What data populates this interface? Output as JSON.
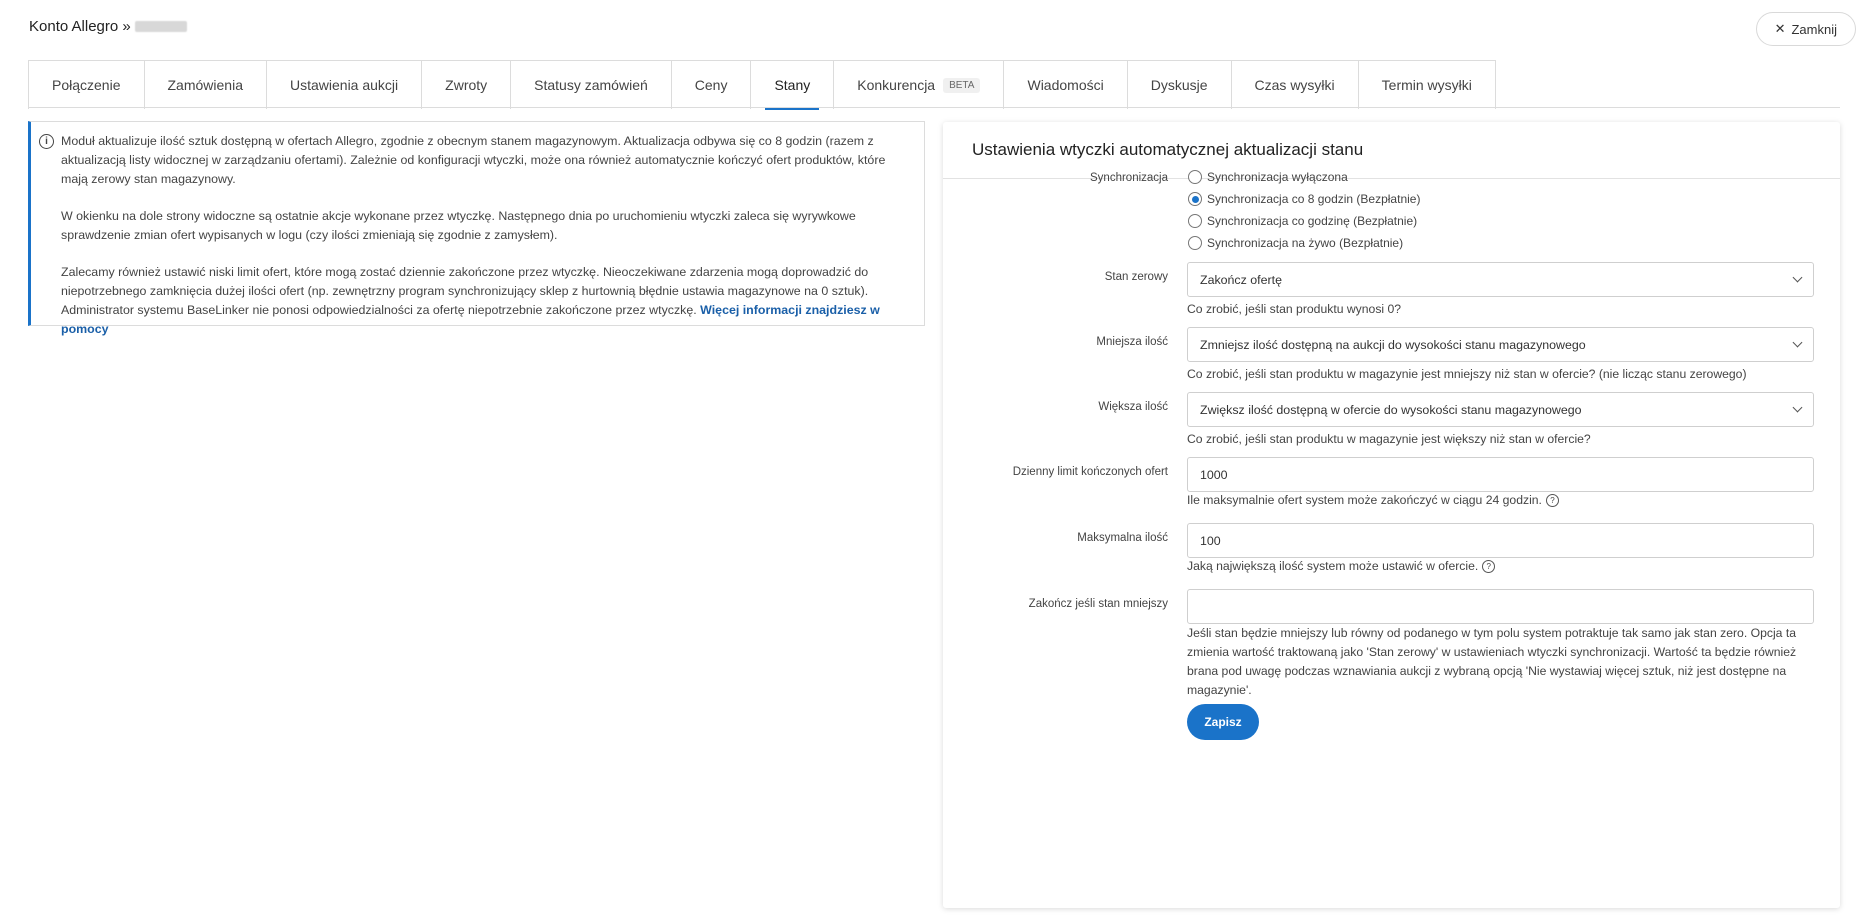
{
  "header": {
    "title": "Konto Allegro »",
    "close_label": "Zamknij"
  },
  "tabs": [
    {
      "label": "Połączenie"
    },
    {
      "label": "Zamówienia"
    },
    {
      "label": "Ustawienia aukcji"
    },
    {
      "label": "Zwroty"
    },
    {
      "label": "Statusy zamówień"
    },
    {
      "label": "Ceny"
    },
    {
      "label": "Stany",
      "active": true
    },
    {
      "label": "Konkurencja",
      "badge": "BETA"
    },
    {
      "label": "Wiadomości"
    },
    {
      "label": "Dyskusje"
    },
    {
      "label": "Czas wysyłki"
    },
    {
      "label": "Termin wysyłki"
    }
  ],
  "info": {
    "p1": "Moduł aktualizuje ilość sztuk dostępną w ofertach Allegro, zgodnie z obecnym stanem magazynowym. Aktualizacja odbywa się co 8 godzin (razem z aktualizacją listy widocznej w zarządzaniu ofertami). Zależnie od konfiguracji wtyczki, może ona również automatycznie kończyć ofert produktów, które mają zerowy stan magazynowy.",
    "p2": "W okienku na dole strony widoczne są ostatnie akcje wykonane przez wtyczkę. Następnego dnia po uruchomieniu wtyczki zaleca się wyrywkowe sprawdzenie zmian ofert wypisanych w logu (czy ilości zmieniają się zgodnie z zamysłem).",
    "p3": "Zalecamy również ustawić niski limit ofert, które mogą zostać dziennie zakończone przez wtyczkę. Nieoczekiwane zdarzenia mogą doprowadzić do niepotrzebnego zamknięcia dużej ilości ofert (np. zewnętrzny program synchronizujący sklep z hurtownią błędnie ustawia magazynowe na 0 sztuk). Administrator systemu BaseLinker nie ponosi odpowiedzialności za ofertę niepotrzebnie zakończone przez wtyczkę.",
    "link": "Więcej informacji znajdziesz w pomocy"
  },
  "panel": {
    "title": "Ustawienia wtyczki automatycznej aktualizacji stanu",
    "sync": {
      "label": "Synchronizacja",
      "options": [
        {
          "label": "Synchronizacja wyłączona",
          "checked": false
        },
        {
          "label": "Synchronizacja co 8 godzin (Bezpłatnie)",
          "checked": true
        },
        {
          "label": "Synchronizacja co godzinę (Bezpłatnie)",
          "checked": false
        },
        {
          "label": "Synchronizacja na żywo (Bezpłatnie)",
          "checked": false
        }
      ]
    },
    "zero": {
      "label": "Stan zerowy",
      "value": "Zakończ ofertę",
      "help": "Co zrobić, jeśli stan produktu wynosi 0?"
    },
    "less": {
      "label": "Mniejsza ilość",
      "value": "Zmniejsz ilość dostępną na aukcji do wysokości stanu magazynowego",
      "help": "Co zrobić, jeśli stan produktu w magazynie jest mniejszy niż stan w ofercie? (nie licząc stanu zerowego)"
    },
    "more": {
      "label": "Większa ilość",
      "value": "Zwiększ ilość dostępną w ofercie do wysokości stanu magazynowego",
      "help": "Co zrobić, jeśli stan produktu w magazynie jest większy niż stan w ofercie?"
    },
    "daily": {
      "label": "Dzienny limit kończonych ofert",
      "value": "1000",
      "help": "Ile maksymalnie ofert system może zakończyć w ciągu 24 godzin."
    },
    "max": {
      "label": "Maksymalna ilość",
      "value": "100",
      "help": "Jaką największą ilość system może ustawić w ofercie."
    },
    "endif": {
      "label": "Zakończ jeśli stan mniejszy",
      "value": "",
      "help": "Jeśli stan będzie mniejszy lub równy od podanego w tym polu system potraktuje tak samo jak stan zero. Opcja ta zmienia wartość traktowaną jako 'Stan zerowy' w ustawieniach wtyczki synchronizacji. Wartość ta będzie również brana pod uwagę podczas wznawiania aukcji z wybraną opcją 'Nie wystawiaj więcej sztuk, niż jest dostępne na magazynie'."
    },
    "save_label": "Zapisz"
  }
}
